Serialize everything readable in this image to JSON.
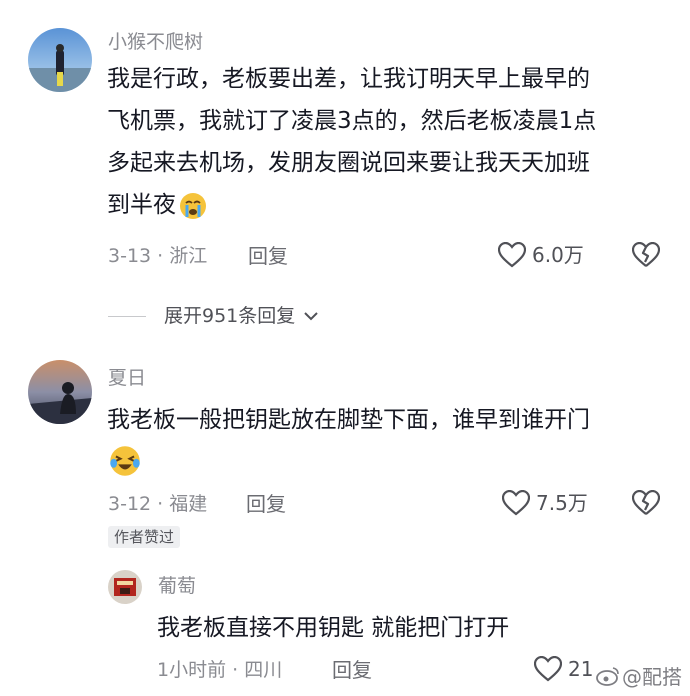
{
  "comments": [
    {
      "username": "小猴不爬树",
      "lines": [
        "我是行政，老板要出差，让我订明天早上最早的",
        "飞机票，我就订了凌晨3点的，然后老板凌晨1点",
        "多起来去机场，发朋友圈说回来要让我天天加班",
        "到半夜"
      ],
      "emoji": "crying-face",
      "date_location": "3-13 · 浙江",
      "reply_label": "回复",
      "likes": "6.0万",
      "expand_label": "展开951条回复"
    },
    {
      "username": "夏日",
      "lines": [
        "我老板一般把钥匙放在脚垫下面，谁早到谁开门"
      ],
      "emoji": "laughing-crying-face",
      "date_location": "3-12 · 福建",
      "reply_label": "回复",
      "likes": "7.5万",
      "badge": "作者赞过"
    }
  ],
  "reply": {
    "username": "葡萄",
    "text": "我老板直接不用钥匙 就能把门打开",
    "date_location": "1小时前 · 四川",
    "reply_label": "回复",
    "likes": "21"
  },
  "watermark": "@配搭",
  "colors": {
    "text": "#161823",
    "secondary": "#8a8b91",
    "accent": "#e8b94a"
  }
}
